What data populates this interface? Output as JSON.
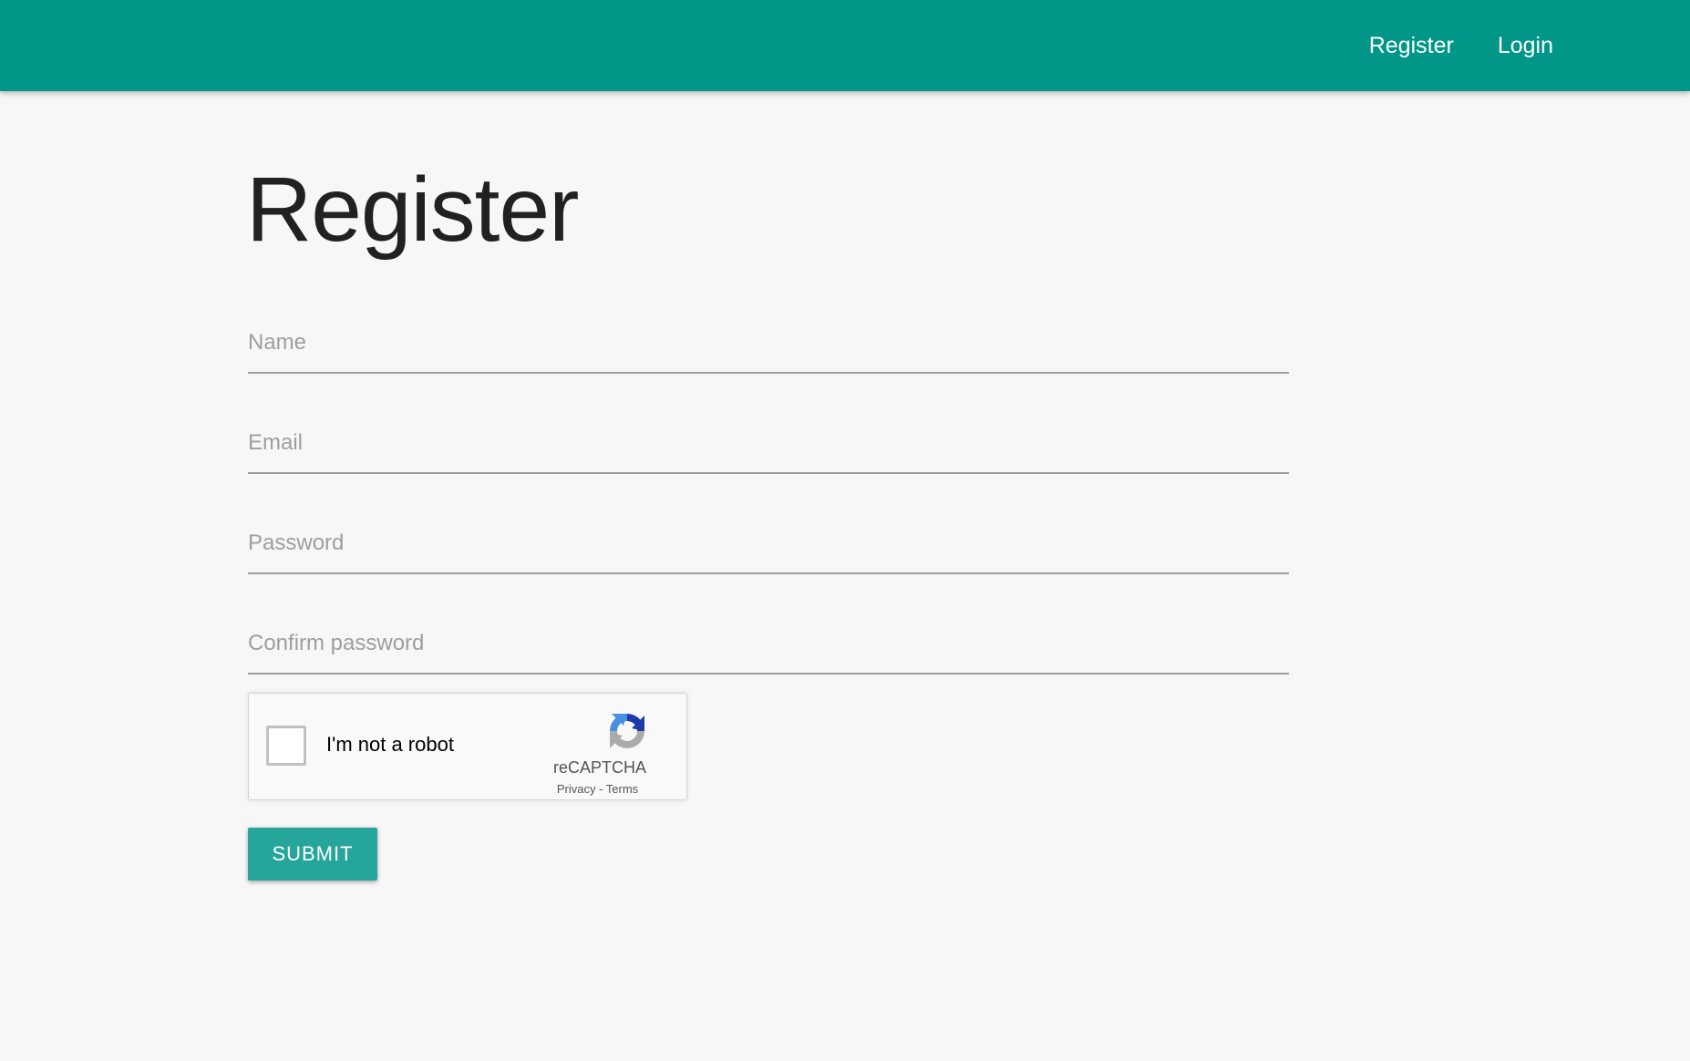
{
  "nav": {
    "links": [
      {
        "label": "Register"
      },
      {
        "label": "Login"
      }
    ]
  },
  "page": {
    "title": "Register"
  },
  "form": {
    "name_placeholder": "Name",
    "email_placeholder": "Email",
    "password_placeholder": "Password",
    "confirm_password_placeholder": "Confirm password",
    "submit_label": "SUBMIT"
  },
  "captcha": {
    "label": "I'm not a robot",
    "brand": "reCAPTCHA",
    "privacy_label": "Privacy",
    "separator": " - ",
    "terms_label": "Terms",
    "checked": false
  },
  "colors": {
    "navbar": "#009688",
    "button": "#26a69a",
    "background": "#f7f7f7",
    "recaptcha_blue": "#1c3aa9",
    "recaptcha_light_blue": "#4a90e2",
    "recaptcha_gray": "#ababab"
  },
  "icons": {
    "captcha_logo": "recaptcha-logo-icon"
  }
}
